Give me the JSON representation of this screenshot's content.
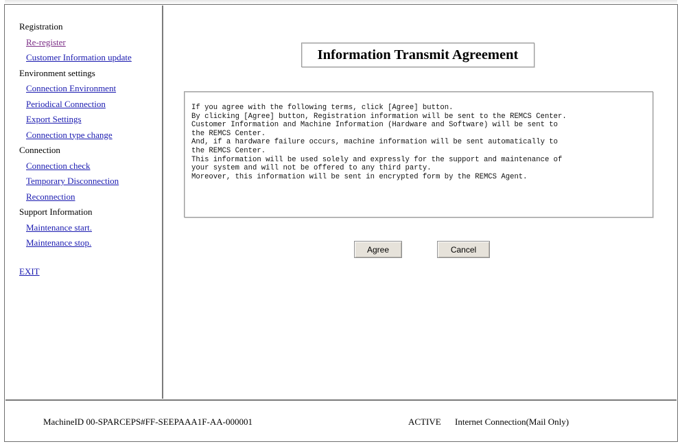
{
  "sidebar": {
    "registration": "Registration",
    "re_register": "Re-register",
    "customer_update": "Customer Information update",
    "environment": "Environment settings",
    "connection_environment": "Connection Environment",
    "periodical_connection": "Periodical Connection",
    "export_settings": "Export Settings",
    "connection_type_change": "Connection type change",
    "connection": "Connection",
    "connection_check": "Connection check",
    "temporary_disconnection": "Temporary Disconnection",
    "reconnection": "Reconnection",
    "support": "Support Information",
    "maintenance_start": "Maintenance start.",
    "maintenance_stop": "Maintenance stop.",
    "exit": "EXIT"
  },
  "main": {
    "title": "Information Transmit Agreement",
    "terms": [
      "If you agree with the following terms, click [Agree] button.",
      "By clicking [Agree] button, Registration information will be sent to the REMCS Center.",
      "Customer Information and Machine Information (Hardware and Software) will be sent to",
      "the REMCS Center.",
      "And, if a hardware failure occurs, machine information will be sent automatically to",
      "the REMCS Center.",
      "This information will be used solely and expressly for the support and maintenance of",
      "your system and will not be offered to any third party.",
      "Moreover, this information will be sent in encrypted form by the REMCS Agent."
    ],
    "agree_label": "Agree",
    "cancel_label": "Cancel"
  },
  "footer": {
    "machine_id": "MachineID  00-SPARCEPS#FF-SEEPAAA1F-AA-000001",
    "status": "ACTIVE",
    "connection": "Internet Connection(Mail Only)"
  },
  "colors": {
    "link": "#1a1ab0",
    "visited_link": "#7b2e86",
    "button_face": "#e6e2da",
    "border": "#7a7a7a"
  }
}
